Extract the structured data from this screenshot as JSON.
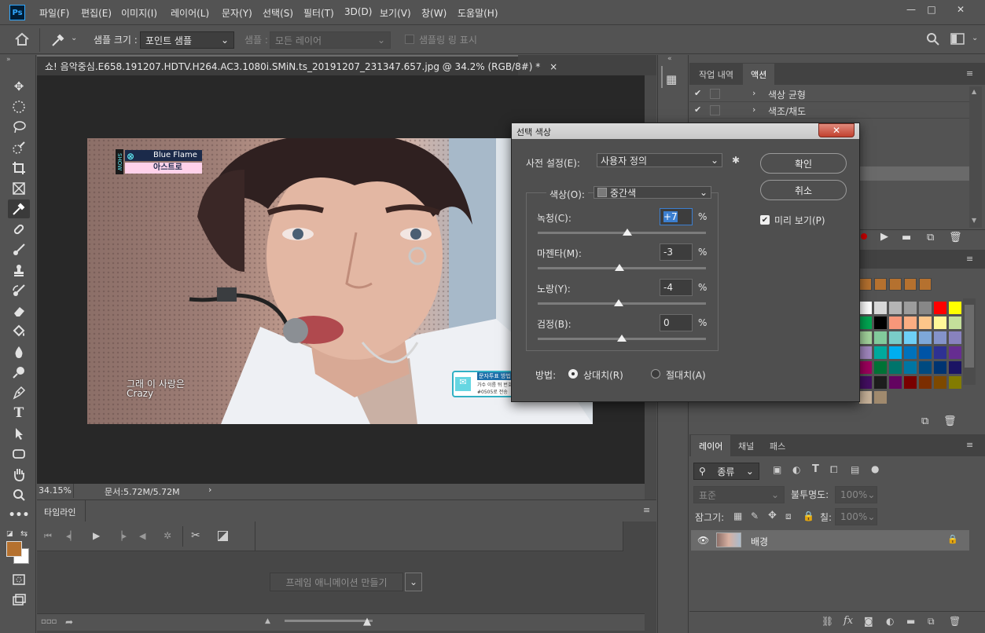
{
  "menubar": {
    "logo": "Ps",
    "items": [
      "파일(F)",
      "편집(E)",
      "이미지(I)",
      "레이어(L)",
      "문자(Y)",
      "선택(S)",
      "필터(T)",
      "3D(D)",
      "보기(V)",
      "창(W)",
      "도움말(H)"
    ],
    "window_buttons": [
      "—",
      "□",
      "✕"
    ]
  },
  "options": {
    "sample_size_label": "샘플 크기 :",
    "sample_size_value": "포인트 샘플",
    "sample_label": "샘플 :",
    "sample_value": "모든 레이어",
    "show_ring_label": "샘플링 링 표시"
  },
  "document": {
    "tab_title": "쇼! 음악중심.E658.191207.HDTV.H264.AC3.1080i.SMiN.ts_20191207_231347.657.jpg @ 34.2% (RGB/8#) *",
    "tab_close": "×",
    "zoom": "34.15%",
    "doc_size": "문서:5.72M/5.72M",
    "status_arrow": "›",
    "overlay_song": "Blue Flame",
    "overlay_artist": "아스트로",
    "overlay_show": "SHOW",
    "subtitle_line1": "그래 이 사랑은",
    "subtitle_line2": "Crazy",
    "vote_line1": "문자투표 방법",
    "vote_line2": "가수 이름 뒤 번호",
    "vote_line3": "#0505로 전송"
  },
  "timeline": {
    "tab": "타임라인",
    "create_button": "프레임 애니메이션 만들기"
  },
  "history_panel": {
    "tabs": [
      "작업 내역",
      "액션"
    ],
    "active_tab": "액션",
    "rows": [
      {
        "label": "색상 균형",
        "checked": true
      },
      {
        "label": "색조/채도",
        "checked": true
      }
    ]
  },
  "swatches": {
    "colors": [
      "#b5712f",
      "#b5712f",
      "#b5712f",
      "#b5712f",
      "#b5712f",
      "#ffffff",
      "#d8d8d8",
      "#b4b4b4",
      "#9c9c9c",
      "#878787",
      "#ff0000",
      "#ffff00",
      "#00a651",
      "#000000",
      "#f7977a",
      "#fbad82",
      "#fdc68a",
      "#fff799",
      "#c4df9b",
      "#a3d39c",
      "#82ca9c",
      "#7accc8",
      "#6ecff6",
      "#7ea7d8",
      "#8493ca",
      "#8882be",
      "#a187be",
      "#00a99d",
      "#00aeef",
      "#0072bc",
      "#0054a6",
      "#2e3192",
      "#662d91",
      "#9e005d",
      "#007236",
      "#00746b",
      "#0076a3",
      "#004a80",
      "#003471",
      "#1b1464",
      "#440e62",
      "#1d1d1d",
      "#630460",
      "#790000",
      "#7b2e00",
      "#7d4900",
      "#827b00",
      "#c7b299",
      "#a08a6e"
    ]
  },
  "layers_panel": {
    "tabs": [
      "레이어",
      "채널",
      "패스"
    ],
    "filter_label": "종류",
    "blend_mode": "표준",
    "opacity_label": "불투명도:",
    "opacity_value": "100%",
    "lock_label": "잠그기:",
    "fill_label": "칠:",
    "fill_value": "100%",
    "layer_name": "배경"
  },
  "dialog": {
    "title": "선택 색상",
    "close": "✕",
    "preset_label": "사전 설정(E):",
    "preset_value": "사용자 정의",
    "ok": "확인",
    "cancel": "취소",
    "preview_label": "미리 보기(P)",
    "preview_checked": true,
    "colors_label": "색상(O):",
    "colors_value": "중간색",
    "percent": "%",
    "sliders": [
      {
        "label": "녹청(C):",
        "value": "+7",
        "level": 7
      },
      {
        "label": "마젠타(M):",
        "value": "-3",
        "level": -3
      },
      {
        "label": "노랑(Y):",
        "value": "-4",
        "level": -4
      },
      {
        "label": "검정(B):",
        "value": "0",
        "level": 0
      }
    ],
    "method_label": "방법:",
    "method_relative": "상대치(R)",
    "method_absolute": "절대치(A)",
    "method_selected": "상대치(R)"
  },
  "colors": {
    "foreground": "#b5712f",
    "background": "#ffffff",
    "accent": "#31a8ff"
  }
}
